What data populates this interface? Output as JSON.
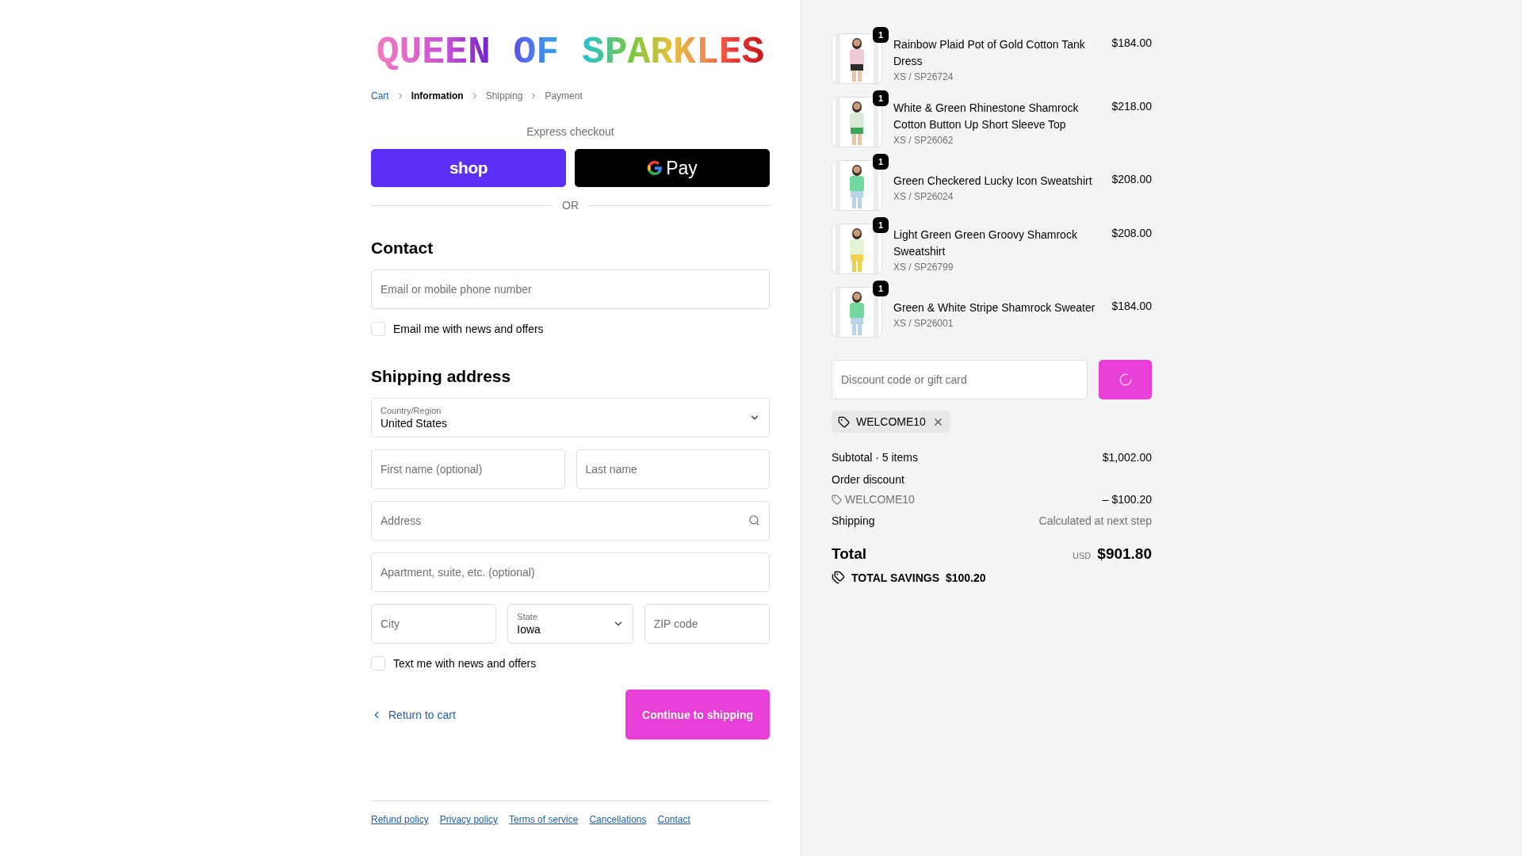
{
  "logo": "QUEEN OF SPARKLES",
  "breadcrumb": [
    {
      "label": "Cart",
      "completed": true,
      "selected": false
    },
    {
      "label": "Information",
      "completed": false,
      "selected": true
    },
    {
      "label": "Shipping",
      "completed": false,
      "selected": false
    },
    {
      "label": "Payment",
      "completed": false,
      "selected": false
    }
  ],
  "express_checkout": {
    "title": "Express checkout",
    "shop_label": "shop",
    "gpay_label": "Pay",
    "divider": "OR"
  },
  "contact": {
    "heading": "Contact",
    "email_placeholder": "Email or mobile phone number",
    "newsletter": {
      "label": "Email me with news and offers",
      "checked": false
    }
  },
  "shipping_address": {
    "heading": "Shipping address",
    "country": {
      "label": "Country/Region",
      "value": "United States"
    },
    "first_name_placeholder": "First name (optional)",
    "last_name_placeholder": "Last name",
    "address_placeholder": "Address",
    "apartment_placeholder": "Apartment, suite, etc. (optional)",
    "city_placeholder": "City",
    "state": {
      "label": "State",
      "value": "Iowa"
    },
    "zip_placeholder": "ZIP code",
    "sms": {
      "label": "Text me with news and offers",
      "checked": false
    }
  },
  "actions": {
    "back": "Return to cart",
    "continue": "Continue to shipping"
  },
  "footer_links": [
    "Refund policy",
    "Privacy policy",
    "Terms of service",
    "Cancellations",
    "Contact"
  ],
  "cart_items": [
    {
      "name": "Rainbow Plaid Pot of Gold Cotton Tank Dress",
      "variant": "XS / SP26724",
      "price": "$184.00",
      "quantity": "1"
    },
    {
      "name": "White & Green Rhinestone Shamrock Cotton Button Up Short Sleeve Top",
      "variant": "XS / SP26062",
      "price": "$218.00",
      "quantity": "1"
    },
    {
      "name": "Green Checkered Lucky Icon Sweatshirt",
      "variant": "XS / SP26024",
      "price": "$208.00",
      "quantity": "1"
    },
    {
      "name": "Light Green Green Groovy Shamrock Sweatshirt",
      "variant": "XS / SP26799",
      "price": "$208.00",
      "quantity": "1"
    },
    {
      "name": "Green & White Stripe Shamrock Sweater",
      "variant": "XS / SP26001",
      "price": "$184.00",
      "quantity": "1"
    }
  ],
  "discount": {
    "placeholder": "Discount code or gift card",
    "loading": true,
    "applied_code": "WELCOME10"
  },
  "summary": {
    "subtotal": {
      "label": "Subtotal · 5 items",
      "value": "$1,002.00"
    },
    "order_discount": {
      "label": "Order discount",
      "code": "WELCOME10",
      "amount": "– $100.20"
    },
    "shipping": {
      "label": "Shipping",
      "value": "Calculated at next step"
    },
    "total": {
      "label": "Total",
      "currency": "USD",
      "value": "$901.80"
    },
    "savings": {
      "label": "TOTAL SAVINGS",
      "value": "$100.20"
    }
  }
}
